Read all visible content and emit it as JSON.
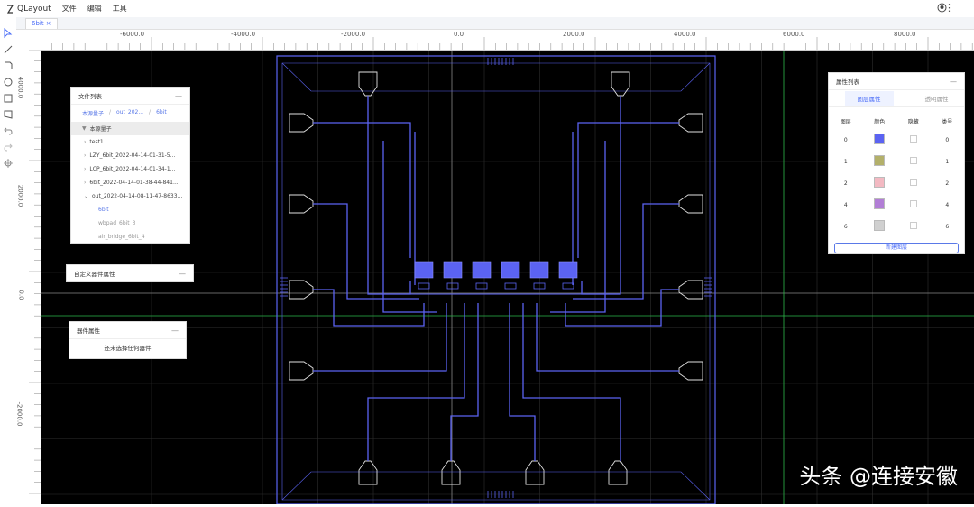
{
  "app": {
    "title": "QLayout",
    "menu": [
      "文件",
      "编辑",
      "工具"
    ]
  },
  "tab": {
    "label": "6bit ×"
  },
  "ruler": {
    "top_ticks": [
      "-6000.0",
      "-4000.0",
      "-2000.0",
      "0.0",
      "2000.0",
      "4000.0",
      "6000.0",
      "8000.0"
    ],
    "left_ticks": [
      "4000.0",
      "2000.0",
      "0.0",
      "-2000.0"
    ]
  },
  "file_panel": {
    "title": "文件列表",
    "breadcrumbs": [
      "本源量子",
      "out_202...",
      "6bit"
    ],
    "root": "本源量子",
    "items": [
      "test1",
      "LZY_6bit_2022-04-14-01-31-5...",
      "LCP_6bit_2022-04-14-01-34-1...",
      "6bit_2022-04-14-01-38-44-841...",
      "out_2022-04-14-08-11-47-8633..."
    ],
    "children": [
      "6bit",
      "wbpad_6bit_3",
      "air_bridge_6bit_4"
    ]
  },
  "custom_panel": {
    "title": "自定义器件属性"
  },
  "device_panel": {
    "title": "器件属性",
    "empty_text": "还未选择任何器件"
  },
  "layer_panel": {
    "title": "属性列表",
    "tab_active": "图层属性",
    "tab_inactive": "透明属性",
    "headers": [
      "图层",
      "颜色",
      "隐藏",
      "类号"
    ],
    "rows": [
      {
        "layer": "0",
        "color": "#5b63f2",
        "num": "0"
      },
      {
        "layer": "1",
        "color": "#b3b06a",
        "num": "1"
      },
      {
        "layer": "2",
        "color": "#f3b9c2",
        "num": "2"
      },
      {
        "layer": "4",
        "color": "#b27ed6",
        "num": "4"
      },
      {
        "layer": "6",
        "color": "#d0d0d0",
        "num": "6"
      }
    ],
    "new_button": "新建图层"
  },
  "watermark": "头条 @连接安徽",
  "colors": {
    "wire": "#5b63f2",
    "pad": "#e0e0e0",
    "grid": "#2e2e2e",
    "axis_green": "#2db84a",
    "accent": "#4a6cf7"
  }
}
